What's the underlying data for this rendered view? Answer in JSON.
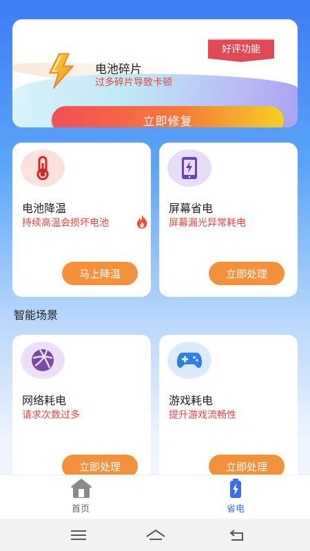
{
  "hero": {
    "title": "电池碎片",
    "subtitle": "过多碎片导致卡顿",
    "badge": "好评功能",
    "button": "立即修复"
  },
  "cards_top": [
    {
      "title": "电池降温",
      "desc": "持续高温会损坏电池",
      "button": "马上降温",
      "icon": "thermometer-icon"
    },
    {
      "title": "屏幕省电",
      "desc": "屏幕漏光异常耗电",
      "button": "立即处理",
      "icon": "phone-charge-icon"
    }
  ],
  "section_title": "智能场景",
  "cards_scene": [
    {
      "title": "网络耗电",
      "desc": "请求次数过多",
      "button": "立即处理",
      "icon": "network-globe-icon"
    },
    {
      "title": "游戏耗电",
      "desc": "提升游戏流畅性",
      "button": "立即处理",
      "icon": "gamepad-icon"
    }
  ],
  "tabs": [
    {
      "label": "首页",
      "icon": "home-icon",
      "active": false
    },
    {
      "label": "省电",
      "icon": "battery-icon",
      "active": true
    }
  ],
  "colors": {
    "accent_red": "#e6453c",
    "button_orange": "#f5903b",
    "tab_active": "#3a6ee8",
    "tab_inactive": "#666666"
  }
}
